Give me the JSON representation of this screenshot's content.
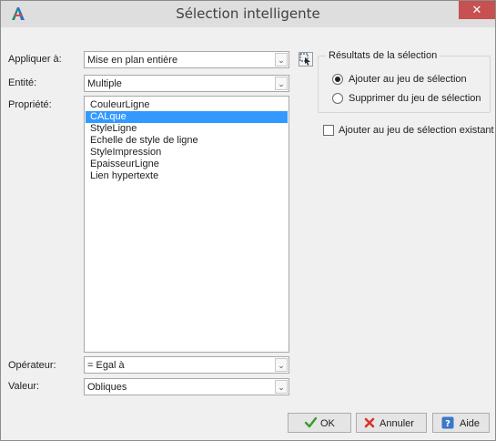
{
  "window": {
    "title": "Sélection intelligente",
    "close_glyph": "✕",
    "icon": "autocad-icon"
  },
  "form": {
    "apply_to": {
      "label": "Appliquer à:",
      "value": "Mise en plan entière"
    },
    "entity": {
      "label": "Entité:",
      "value": "Multiple"
    },
    "property": {
      "label": "Propriété:",
      "items": [
        "CouleurLigne",
        "CALque",
        "StyleLigne",
        "Echelle de style de ligne",
        "StyleImpression",
        "EpaisseurLigne",
        "Lien hypertexte"
      ],
      "selected_index": 1
    },
    "operator": {
      "label": "Opérateur:",
      "value": "= Egal à"
    },
    "value": {
      "label": "Valeur:",
      "value": "Obliques"
    },
    "dropdown_glyph": "⌄"
  },
  "results": {
    "title": "Résultats de la sélection",
    "include": "Ajouter au jeu de sélection",
    "exclude": "Supprimer du jeu de sélection",
    "selected": "include"
  },
  "append": {
    "label": "Ajouter au jeu de sélection existant",
    "checked": false
  },
  "buttons": {
    "ok": "OK",
    "cancel": "Annuler",
    "help": "Aide"
  },
  "colors": {
    "selection": "#3399ff",
    "ok_check": "#3a9a2a",
    "cancel_x": "#d9342b",
    "help_blue": "#3a78c6"
  }
}
